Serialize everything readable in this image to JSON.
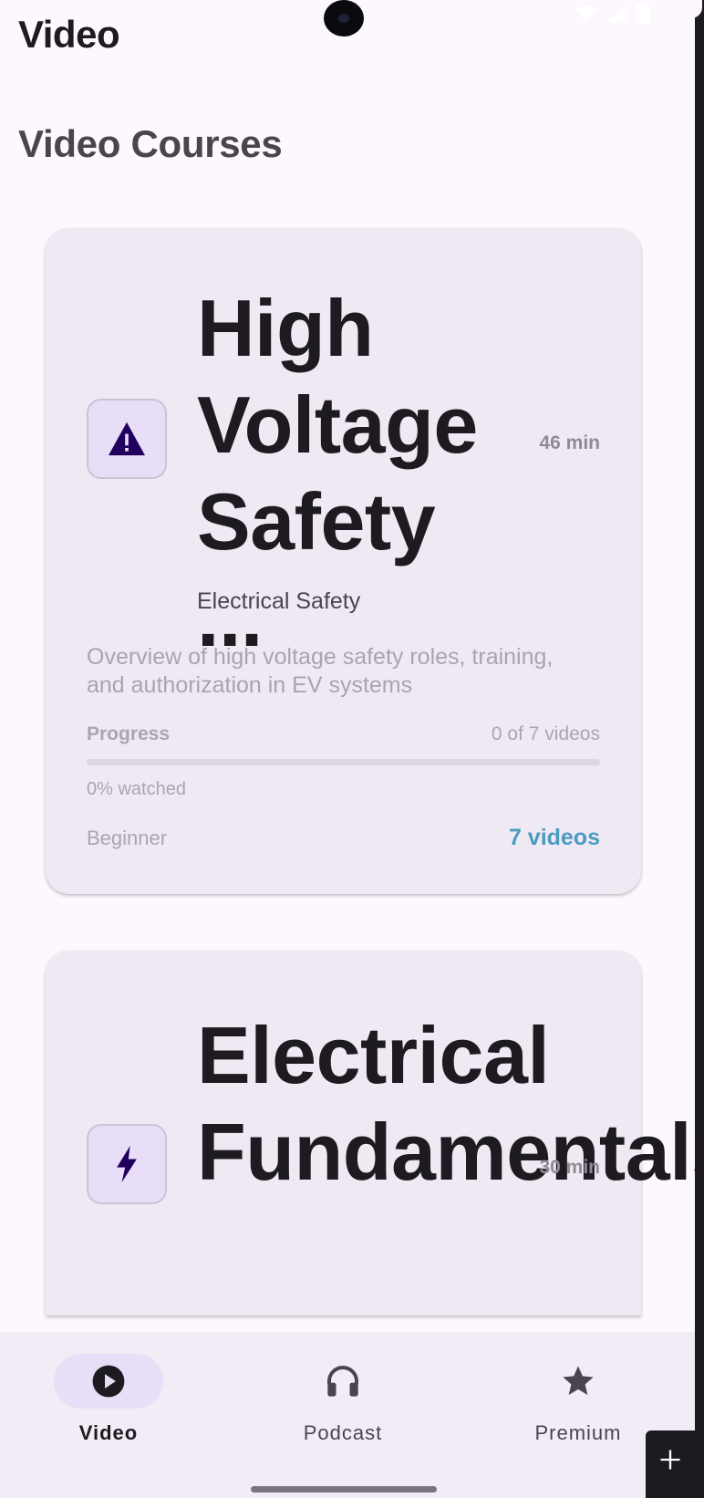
{
  "app": {
    "title": "Video"
  },
  "section": {
    "title": "Video Courses"
  },
  "courses": [
    {
      "icon": "warning-icon",
      "title": "High Voltage Safety ...",
      "duration": "46 min",
      "category": "Electrical Safety",
      "description": "Overview of high voltage safety roles, training, and authorization in EV systems",
      "progress_label": "Progress",
      "progress_count": "0 of 7 videos",
      "progress_fraction": 0,
      "watched": "0% watched",
      "level": "Beginner",
      "video_count": "7 videos"
    },
    {
      "icon": "lightning-icon",
      "title": "Electrical Fundamentals",
      "duration": "30 min"
    }
  ],
  "nav": {
    "items": [
      {
        "label": "Video",
        "icon": "play-circle-icon",
        "active": true
      },
      {
        "label": "Podcast",
        "icon": "headphones-icon",
        "active": false
      },
      {
        "label": "Premium",
        "icon": "star-icon",
        "active": false
      }
    ]
  },
  "colors": {
    "background": "#fdf8fd",
    "card": "#efe9f4",
    "icon_box": "#e8def8",
    "accent": "#4a9cc0",
    "nav_active_pill": "#e8def8"
  }
}
